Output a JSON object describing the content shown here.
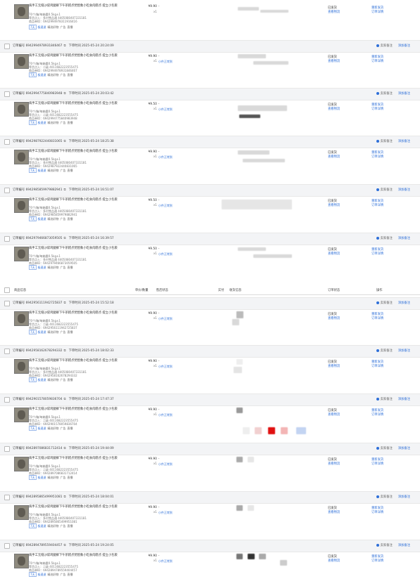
{
  "common": {
    "product_title": "病手工无缝沙袋鸡腿裤下午茶糕点琵琶象小吃食肉糕点 提立小包裹",
    "spec": "70个/箱/每箱重0.5kg±1",
    "warehouse_label": "等货点入：",
    "order_no_label": "商品单ID：",
    "tags_default": [
      "7天",
      "极速退",
      "精选好物",
      "广告",
      "直播"
    ],
    "qty": "x1",
    "dash": "-",
    "after_sale": "小件正常到",
    "status_1": "已发货",
    "status_2": "查看物流",
    "action_1": "重新发货",
    "action_2": "订单详情",
    "order_label": "订单编号",
    "time_label": "下单时间",
    "right_actions": [
      "卖家备注",
      "添加备注"
    ]
  },
  "columns": [
    "商品信息",
    "单价/数量",
    "售后状态",
    "实付",
    "收货信息",
    "订单状态",
    "操作"
  ],
  "orders": [
    {
      "id": "6942994978311916416",
      "time": "2025-05-24 20:55:09",
      "price": "¥9.90",
      "wh": "多村雪品通 4405080407331181",
      "sku": "6942994978311916416"
    },
    {
      "id": "6942994978931846467",
      "time": "2025-05-24 20:24:09",
      "price": "¥9.90",
      "wh": "二级 4011682223555475",
      "sku": "6942994978931846467"
    },
    {
      "id": "6942994775840983948",
      "time": "2025-05-24 20:03:42",
      "price": "¥9.50",
      "wh": "二级 4011682223555475",
      "sku": "6942994775840983948"
    },
    {
      "id": "6942987922440831065",
      "time": "2025-05-24 18:25:38",
      "price": "¥9.90",
      "wh": "多村雪品通 4405080407331181",
      "sku": "6942987922440831065"
    },
    {
      "id": "6942985859979882941",
      "time": "2025-05-24 16:51:07",
      "price": "¥9.50",
      "wh": "多村雪品通 4405080407331181",
      "sku": "6942985859979882941"
    },
    {
      "id": "6942979466873059505",
      "time": "2025-05-24 16:39:57",
      "price": "¥9.50",
      "wh": "多村雪品通 4405080407331181",
      "sku": "6942979466873059505"
    },
    {
      "id": "6942956111942725837",
      "time": "2025-05-24 15:52:18",
      "price": "¥9.90",
      "wh": "二级 4011682223555475",
      "sku": "6942956111942725837"
    },
    {
      "id": "6942958162678294332",
      "time": "2025-05-24 18:02:33",
      "price": "¥9.90",
      "wh": "多村雪品通 4405080407331181",
      "sku": "6942958162678294332"
    },
    {
      "id": "6942901578059836704",
      "time": "2025-05-24 17:47:37",
      "price": "¥9.90",
      "wh": "二级 4011682223555475",
      "sku": "6942901578059836704"
    },
    {
      "id": "6942897086831712414",
      "time": "2025-05-24 19:44:09",
      "price": "¥9.90",
      "wh": "二级 4011682223555475",
      "sku": "6942897086831712414"
    },
    {
      "id": "6942895865499951081",
      "time": "2025-05-24 18:04:01",
      "price": "¥9.90",
      "wh": "多村雪品通 4405080407331181",
      "sku": "6942895865499951081"
    },
    {
      "id": "6942894789559404457",
      "time": "2025-05-24 19:24:05",
      "price": "¥9.90",
      "wh": "二级 4011682223555475",
      "sku": "6942894789559404457"
    }
  ]
}
